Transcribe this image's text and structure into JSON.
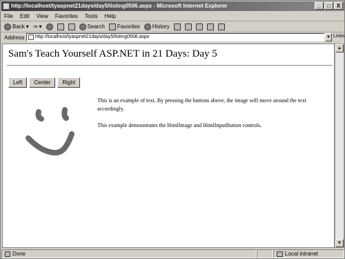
{
  "window": {
    "title": "http://localhost/tyaspnet21days/day5/listing0506.aspx - Microsoft Internet Explorer",
    "minimize": "_",
    "maximize": "□",
    "close": "X"
  },
  "menu": [
    "File",
    "Edit",
    "View",
    "Favorites",
    "Tools",
    "Help"
  ],
  "toolbar": {
    "back": "Back",
    "search": "Search",
    "favorites": "Favorites",
    "history": "History"
  },
  "address": {
    "label": "Address",
    "url": "http://localhost/tyaspnet21days/day5/listing0506.aspx",
    "links": "Links"
  },
  "page": {
    "heading": "Sam's Teach Yourself ASP.NET in 21 Days: Day 5",
    "buttons": [
      "Left",
      "Center",
      "Right"
    ],
    "paragraph1": "This is an example of text. By pressing the buttons above, the image will move around the text accordingly.",
    "paragraph2": "This example demonstrates the HtmlImage and HtmlInputButton controls."
  },
  "status": {
    "text": "Done",
    "zone": "Local intranet"
  }
}
